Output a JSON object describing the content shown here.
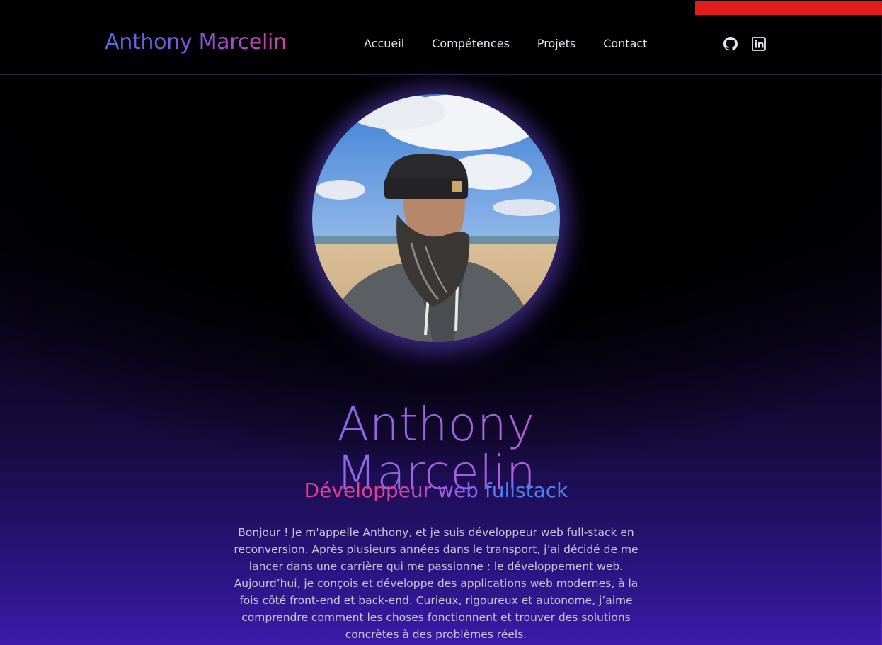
{
  "header": {
    "brand": "Anthony Marcelin",
    "nav": [
      {
        "label": "Accueil"
      },
      {
        "label": "Compétences"
      },
      {
        "label": "Projets"
      },
      {
        "label": "Contact"
      }
    ],
    "social": [
      {
        "icon": "github-icon"
      },
      {
        "icon": "linkedin-icon"
      }
    ]
  },
  "hero": {
    "name_line1": "Anthony",
    "name_line2": "Marcelin",
    "role": "Développeur web fullstack",
    "bio": "Bonjour ! Je m'appelle Anthony, et je suis développeur web full-stack en reconversion. Après plusieurs années dans le transport, j’ai décidé de me lancer dans une carrière qui me passionne : le développement web. Aujourd’hui, je conçois et développe des applications web modernes, à la fois côté front-end et back-end. Curieux, rigoureux et autonome, j’aime comprendre comment les choses fonctionnent et trouver des solutions concrètes à des problèmes réels."
  },
  "colors": {
    "accent_bar": "#e21d1d",
    "brand_gradient_start": "#4f6ae0",
    "brand_gradient_end": "#d041a6",
    "background_bottom": "#3a1ba8"
  }
}
